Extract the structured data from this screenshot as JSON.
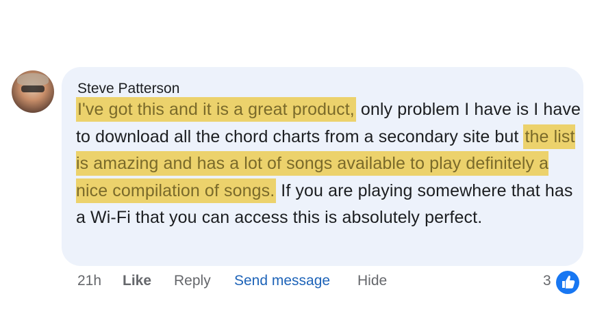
{
  "comment": {
    "author": "Steve Patterson",
    "segments": [
      {
        "text": "I've got this and it is a great product,",
        "highlighted": true
      },
      {
        "text": " only problem I have is I have to download all the chord charts from a secondary site but ",
        "highlighted": false
      },
      {
        "text": "the list is amazing and has a lot of songs available to play definitely a nice compilation of songs.",
        "highlighted": true
      },
      {
        "text": " If you are playing somewhere that has a Wi-Fi that you can access this is absolutely perfect.",
        "highlighted": false
      }
    ]
  },
  "actions": {
    "time": "21h",
    "like": "Like",
    "reply": "Reply",
    "send_message": "Send message",
    "hide": "Hide"
  },
  "reactions": {
    "count": "3",
    "icon": "thumbs-up-icon"
  },
  "colors": {
    "bubble": "#edf2fb",
    "highlight": "#ecd26c",
    "link": "#1d63b8",
    "like_badge": "#1877f2"
  }
}
